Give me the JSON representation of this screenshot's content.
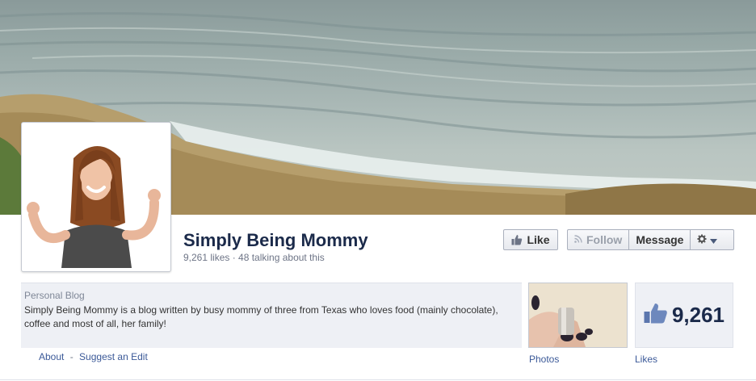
{
  "page": {
    "title": "Simply Being Mommy",
    "stats": "9,261 likes · 48 talking about this"
  },
  "actions": {
    "like_label": "Like",
    "follow_label": "Follow",
    "message_label": "Message"
  },
  "about": {
    "category": "Personal Blog",
    "description": "Simply Being Mommy is a blog written by busy mommy of three from Texas who loves food (mainly chocolate), coffee and most of all, her family!"
  },
  "links": {
    "about": "About",
    "separator": "-",
    "suggest_edit": "Suggest an Edit"
  },
  "tiles": {
    "photos_label": "Photos",
    "likes_count": "9,261",
    "likes_label": "Likes"
  },
  "icons": {
    "like": "thumbs-up-icon",
    "follow": "rss-icon",
    "settings": "gear-icon",
    "dropdown": "chevron-down-icon"
  },
  "colors": {
    "title": "#1b2a4a",
    "link": "#3b5998",
    "panel": "#eef0f5"
  }
}
